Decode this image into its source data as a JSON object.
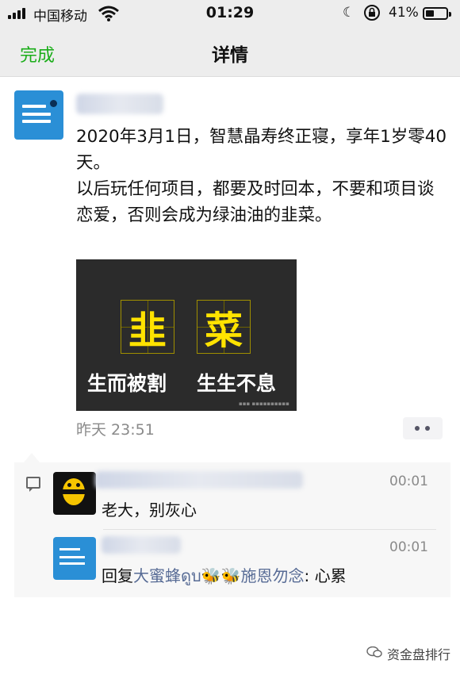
{
  "status_bar": {
    "carrier": "中国移动",
    "time": "01:29",
    "battery_pct": "41%",
    "battery_level": 0.41
  },
  "nav": {
    "back_label": "完成",
    "title": "详情"
  },
  "post": {
    "lines": [
      "2020年3月1日，智慧晶寿终正寝，享年1岁零40天。",
      "以后玩任何项目，都要及时回本，不要和项目谈恋爱，否则会成为绿油油的韭菜。"
    ],
    "image": {
      "char1": "韭",
      "char2": "菜",
      "caption1": "生而被割",
      "caption2": "生生不息"
    },
    "timestamp": "昨天 23:51"
  },
  "comments": [
    {
      "time": "00:01",
      "text": "老大，别灰心"
    },
    {
      "time": "00:01",
      "reply_prefix": "回复",
      "reply_to": "大蜜蜂ดูบ🐝🐝施恩勿念",
      "text": ": 心累"
    }
  ],
  "footer": {
    "label": "资金盘排行"
  },
  "colors": {
    "accent_green": "#1aad19",
    "link_blue": "#576b95",
    "highlight_yellow": "#ffe300"
  }
}
